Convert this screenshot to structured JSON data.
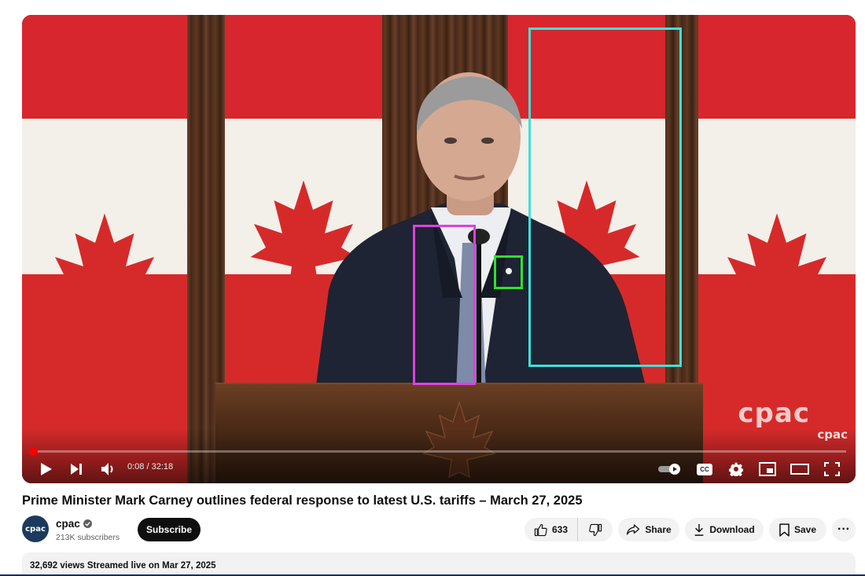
{
  "video": {
    "current_time": "0:08",
    "duration": "32:18",
    "time_display": "0:08 / 32:18",
    "progress_percent": 0.4,
    "watermark_big": "cpac",
    "watermark_small": "cpac"
  },
  "controls": {
    "play_icon": "play-icon",
    "next_icon": "next-icon",
    "volume_icon": "volume-icon",
    "autoplay_icon": "autoplay-toggle-icon",
    "cc_label": "CC",
    "settings_icon": "gear-icon",
    "miniplayer_icon": "miniplayer-icon",
    "theater_icon": "theater-icon",
    "fullscreen_icon": "fullscreen-icon"
  },
  "annotations": {
    "colors": {
      "cyan": "#3fe0d8",
      "magenta": "#e040e0",
      "green": "#2fe02f"
    }
  },
  "title": "Prime Minister Mark Carney outlines federal response to latest U.S. tariffs – March 27, 2025",
  "channel": {
    "avatar_text": "cpac",
    "name": "cpac",
    "subscribers": "213K subscribers",
    "subscribe_label": "Subscribe"
  },
  "actions": {
    "like_count": "633",
    "share_label": "Share",
    "download_label": "Download",
    "save_label": "Save",
    "more_label": "···"
  },
  "description": {
    "summary": "32,692 views  Streamed live on Mar 27, 2025"
  },
  "colors": {
    "accent_red": "#ff0000",
    "subscribe_bg": "#0f0f0f",
    "pill_bg": "#f2f2f2"
  }
}
